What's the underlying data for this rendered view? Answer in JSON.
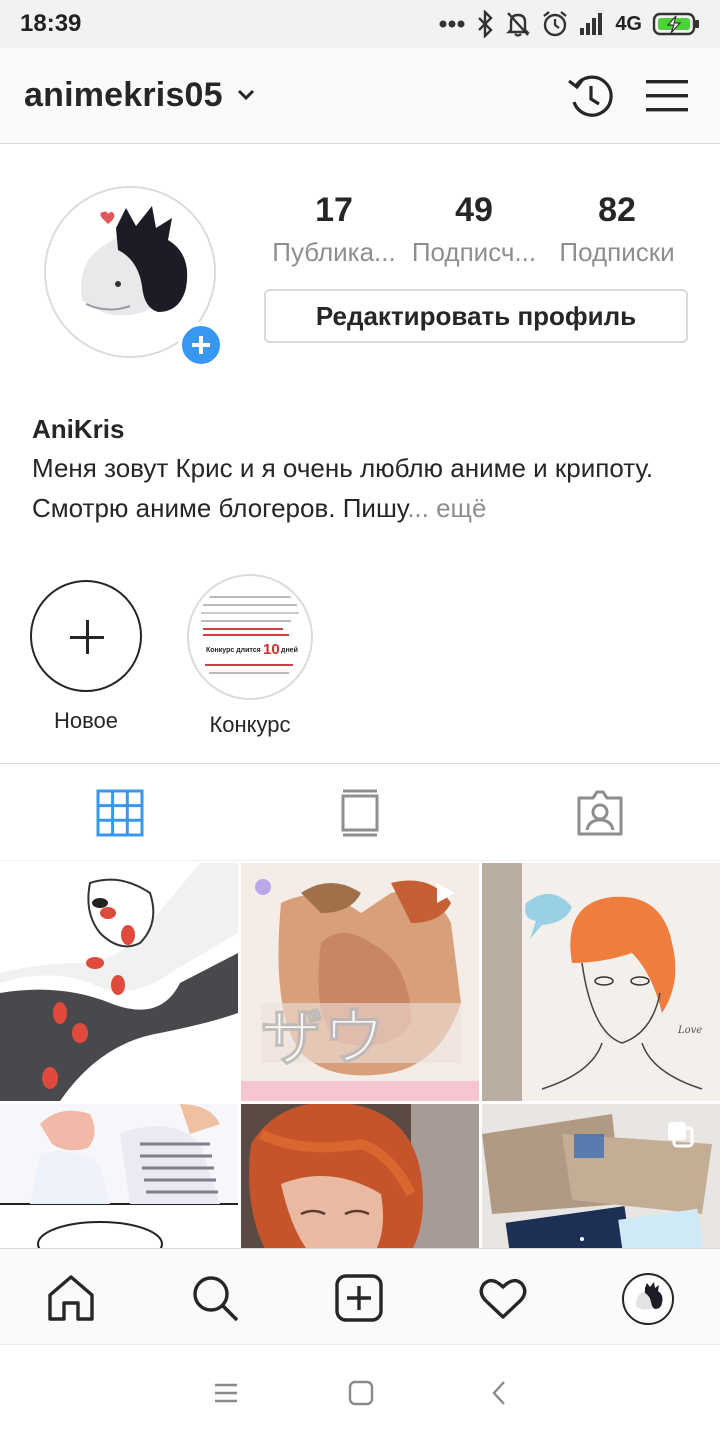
{
  "status_bar": {
    "time": "18:39",
    "network": "4G",
    "icons": [
      "more-dots-icon",
      "bluetooth-icon",
      "mute-bell-icon",
      "alarm-icon",
      "signal-icon",
      "battery-charging-icon"
    ]
  },
  "header": {
    "username": "animekris05",
    "icons": [
      "chevron-down-icon",
      "history-icon",
      "menu-icon"
    ]
  },
  "profile": {
    "stats": [
      {
        "value": "17",
        "label": "Публика..."
      },
      {
        "value": "49",
        "label": "Подписч..."
      },
      {
        "value": "82",
        "label": "Подписки"
      }
    ],
    "edit_button": "Редактировать профиль",
    "name": "AniKris",
    "bio": "Меня зовут Крис и я очень люблю аниме и крипоту. Смотрю аниме блогеров. Пишу",
    "bio_more": "... ещё"
  },
  "highlights": [
    {
      "label": "Новое"
    },
    {
      "label": "Конкурс",
      "cover_text": {
        "days_number": "10",
        "line1": "Конкурс длится",
        "line2": "дней"
      }
    }
  ],
  "tabs": {
    "icons": [
      "grid-icon",
      "feed-icon",
      "tagged-icon"
    ],
    "active": "grid-icon"
  },
  "bottom_nav": {
    "icons": [
      "home-icon",
      "search-icon",
      "add-post-icon",
      "heart-icon",
      "profile-avatar-icon"
    ]
  },
  "colors": {
    "accent": "#3897f0",
    "text": "#262626",
    "muted": "#8e8e8e",
    "border": "#dbdbdb"
  }
}
